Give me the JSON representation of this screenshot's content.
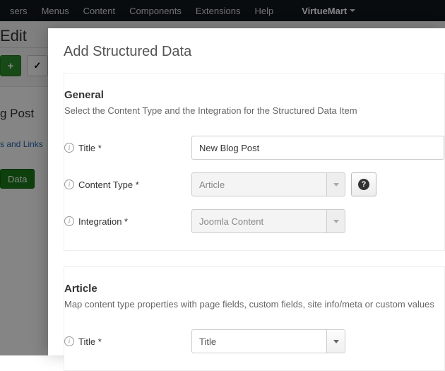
{
  "topbar": {
    "items": [
      "sers",
      "Menus",
      "Content",
      "Components",
      "Extensions",
      "Help"
    ],
    "vm": "VirtueMart"
  },
  "page": {
    "title": "Edit",
    "heading": "g Post",
    "links_line": "s and Links",
    "data_btn": "Data"
  },
  "modal": {
    "title": "Add Structured Data",
    "general": {
      "heading": "General",
      "sub": "Select the Content Type and the Integration for the Structured Data Item",
      "title_label": "Title *",
      "title_value": "New Blog Post",
      "content_type_label": "Content Type *",
      "content_type_value": "Article",
      "integration_label": "Integration *",
      "integration_value": "Joomla Content"
    },
    "article": {
      "heading": "Article",
      "sub": "Map content type properties with page fields, custom fields, site info/meta or custom values",
      "title_label": "Title *",
      "title_value": "Title"
    }
  }
}
